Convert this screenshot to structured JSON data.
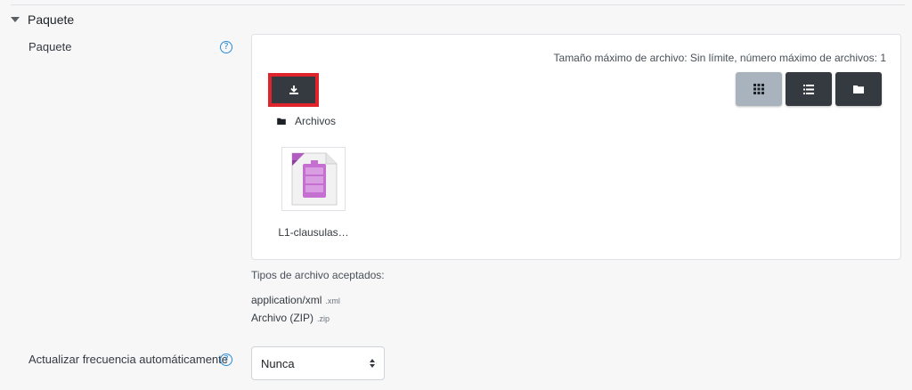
{
  "section": {
    "title": "Paquete"
  },
  "package_field": {
    "label": "Paquete",
    "help_glyph": "?",
    "limits_text": "Tamaño máximo de archivo: Sin límite, número máximo de archivos: 1",
    "path_label": "Archivos",
    "files": [
      {
        "name": "L1-clausulas…",
        "icon": "xml-file-icon"
      }
    ],
    "view_modes": [
      {
        "icon": "grid-icon",
        "active": true
      },
      {
        "icon": "list-icon",
        "active": false
      },
      {
        "icon": "folder-icon",
        "active": false
      }
    ]
  },
  "accepted_types": {
    "title": "Tipos de archivo aceptados:",
    "items": [
      {
        "name": "application/xml",
        "ext": ".xml"
      },
      {
        "name": "Archivo (ZIP)",
        "ext": ".zip"
      }
    ]
  },
  "update_frequency": {
    "label": "Actualizar frecuencia automáticamente",
    "help_glyph": "?",
    "selected": "Nunca"
  },
  "colors": {
    "accent": "#2a8bd4",
    "highlight": "#e0242b",
    "dark_button": "#343a40",
    "active_view": "#a9b3bd"
  }
}
